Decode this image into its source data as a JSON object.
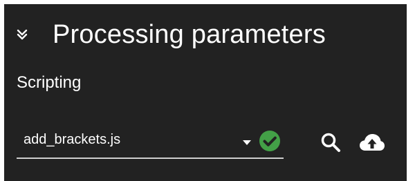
{
  "panel": {
    "title": "Processing parameters",
    "collapse_icon": "double-chevron-down-icon"
  },
  "scripting": {
    "label": "Scripting",
    "selected_script": "add_brackets.js",
    "dropdown_icon": "caret-down-icon",
    "status_icon": "check-circle-icon",
    "status_color": "#43a047",
    "search_icon": "search-icon",
    "upload_icon": "cloud-upload-icon"
  },
  "colors": {
    "background": "#222222",
    "text": "#ffffff",
    "underline": "#cfcfcf",
    "success": "#43a047"
  }
}
